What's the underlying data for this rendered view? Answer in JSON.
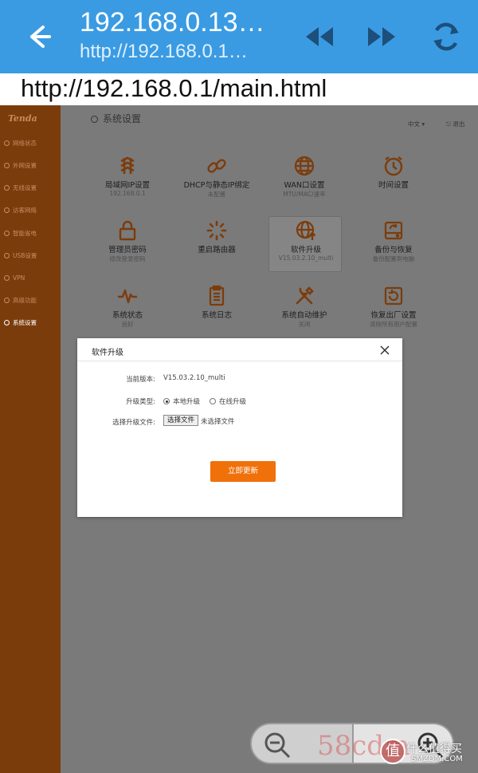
{
  "browser": {
    "title": "192.168.0.13…",
    "subtitle": "http://192.168.0.1…",
    "url": "http://192.168.0.1/main.html",
    "icons": [
      "arrow-left-icon",
      "rewind-icon",
      "fast-forward-icon",
      "refresh-icon"
    ]
  },
  "router": {
    "logo": "Tenda",
    "sidebar": [
      {
        "label": "网络状态",
        "active": false
      },
      {
        "label": "外网设置",
        "active": false
      },
      {
        "label": "无线设置",
        "active": false
      },
      {
        "label": "访客网络",
        "active": false
      },
      {
        "label": "智能省电",
        "active": false
      },
      {
        "label": "USB设置",
        "active": false
      },
      {
        "label": "VPN",
        "active": false
      },
      {
        "label": "高级功能",
        "active": false
      },
      {
        "label": "系统设置",
        "active": true
      }
    ],
    "header": {
      "title": "系统设置",
      "language": "中文",
      "logout": "退出"
    },
    "tiles": [
      {
        "label": "局域网IP设置",
        "sub": "192.168.0.1",
        "icon": "network-ip-icon"
      },
      {
        "label": "DHCP与静态IP绑定",
        "sub": "未配置",
        "icon": "link-icon"
      },
      {
        "label": "WAN口设置",
        "sub": "MTU/MAC/速率",
        "icon": "globe-icon"
      },
      {
        "label": "时间设置",
        "sub": "",
        "icon": "clock-icon"
      },
      {
        "label": "管理员密码",
        "sub": "修改登录密码",
        "icon": "lock-icon"
      },
      {
        "label": "重启路由器",
        "sub": "",
        "icon": "reboot-icon"
      },
      {
        "label": "软件升级",
        "sub": "V15.03.2.10_multi",
        "icon": "upgrade-icon"
      },
      {
        "label": "备份与恢复",
        "sub": "备份配置到电脑",
        "icon": "backup-icon"
      },
      {
        "label": "系统状态",
        "sub": "良好",
        "icon": "pulse-icon"
      },
      {
        "label": "系统日志",
        "sub": "",
        "icon": "log-icon"
      },
      {
        "label": "系统自动维护",
        "sub": "关闭",
        "icon": "tools-icon"
      },
      {
        "label": "恢复出厂设置",
        "sub": "清除所有用户配置",
        "icon": "factory-reset-icon"
      }
    ]
  },
  "modal": {
    "title": "软件升级",
    "current_version_label": "当前版本:",
    "current_version": "V15.03.2.10_multi",
    "upgrade_type_label": "升级类型:",
    "upgrade_type_options": [
      "本地升级",
      "在线升级"
    ],
    "upgrade_type_selected": "本地升级",
    "file_label": "选择升级文件:",
    "file_button": "选择文件",
    "file_status": "未选择文件",
    "update_button": "立即更新"
  },
  "zoom": {
    "icons": [
      "zoom-out-icon",
      "zoom-in-icon"
    ]
  },
  "watermark": {
    "text1": "58cdm",
    "badge": "值",
    "text2": "什么值得买",
    "text3": "SMZDM.COM"
  },
  "colors": {
    "browser_bar": "#3a9be3",
    "sidebar": "#7b3c0c",
    "accent": "#f0700a"
  }
}
